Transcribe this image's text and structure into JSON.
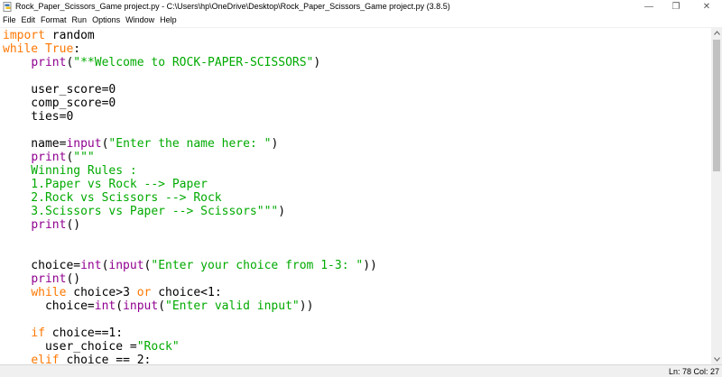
{
  "window": {
    "title": "Rock_Paper_Scissors_Game project.py - C:\\Users\\hp\\OneDrive\\Desktop\\Rock_Paper_Scissors_Game project.py (3.8.5)",
    "controls": {
      "minimize": "—",
      "maximize": "❐",
      "close": "✕"
    }
  },
  "menu": {
    "items": [
      "File",
      "Edit",
      "Format",
      "Run",
      "Options",
      "Window",
      "Help"
    ]
  },
  "editor": {
    "lines": [
      [
        [
          "kw",
          "import"
        ],
        [
          "n",
          " random"
        ]
      ],
      [
        [
          "kw",
          "while"
        ],
        [
          "n",
          " "
        ],
        [
          "kw",
          "True"
        ],
        [
          "n",
          ":"
        ]
      ],
      [
        [
          "n",
          "    "
        ],
        [
          "bi",
          "print"
        ],
        [
          "n",
          "("
        ],
        [
          "str",
          "\"**Welcome to ROCK-PAPER-SCISSORS\""
        ],
        [
          "n",
          ")"
        ]
      ],
      [],
      [
        [
          "n",
          "    user_score=0"
        ]
      ],
      [
        [
          "n",
          "    comp_score=0"
        ]
      ],
      [
        [
          "n",
          "    ties=0"
        ]
      ],
      [],
      [
        [
          "n",
          "    name="
        ],
        [
          "bi",
          "input"
        ],
        [
          "n",
          "("
        ],
        [
          "str",
          "\"Enter the name here: \""
        ],
        [
          "n",
          ")"
        ]
      ],
      [
        [
          "n",
          "    "
        ],
        [
          "bi",
          "print"
        ],
        [
          "n",
          "("
        ],
        [
          "str",
          "\"\"\""
        ]
      ],
      [
        [
          "str",
          "    Winning Rules :"
        ]
      ],
      [
        [
          "str",
          "    1.Paper vs Rock --> Paper"
        ]
      ],
      [
        [
          "str",
          "    2.Rock vs Scissors --> Rock"
        ]
      ],
      [
        [
          "str",
          "    3.Scissors vs Paper --> Scissors\"\"\""
        ],
        [
          "n",
          ")"
        ]
      ],
      [
        [
          "n",
          "    "
        ],
        [
          "bi",
          "print"
        ],
        [
          "n",
          "()"
        ]
      ],
      [],
      [],
      [
        [
          "n",
          "    choice="
        ],
        [
          "bi",
          "int"
        ],
        [
          "n",
          "("
        ],
        [
          "bi",
          "input"
        ],
        [
          "n",
          "("
        ],
        [
          "str",
          "\"Enter your choice from 1-3: \""
        ],
        [
          "n",
          "))"
        ]
      ],
      [
        [
          "n",
          "    "
        ],
        [
          "bi",
          "print"
        ],
        [
          "n",
          "()"
        ]
      ],
      [
        [
          "n",
          "    "
        ],
        [
          "kw",
          "while"
        ],
        [
          "n",
          " choice>3 "
        ],
        [
          "kw",
          "or"
        ],
        [
          "n",
          " choice<1:"
        ]
      ],
      [
        [
          "n",
          "      choice="
        ],
        [
          "bi",
          "int"
        ],
        [
          "n",
          "("
        ],
        [
          "bi",
          "input"
        ],
        [
          "n",
          "("
        ],
        [
          "str",
          "\"Enter valid input\""
        ],
        [
          "n",
          "))"
        ]
      ],
      [],
      [
        [
          "n",
          "    "
        ],
        [
          "kw",
          "if"
        ],
        [
          "n",
          " choice==1:"
        ]
      ],
      [
        [
          "n",
          "      user_choice ="
        ],
        [
          "str",
          "\"Rock\""
        ]
      ],
      [
        [
          "n",
          "    "
        ],
        [
          "kw",
          "elif"
        ],
        [
          "n",
          " choice == 2:"
        ]
      ]
    ]
  },
  "status": {
    "text": "Ln: 78  Col: 27"
  }
}
